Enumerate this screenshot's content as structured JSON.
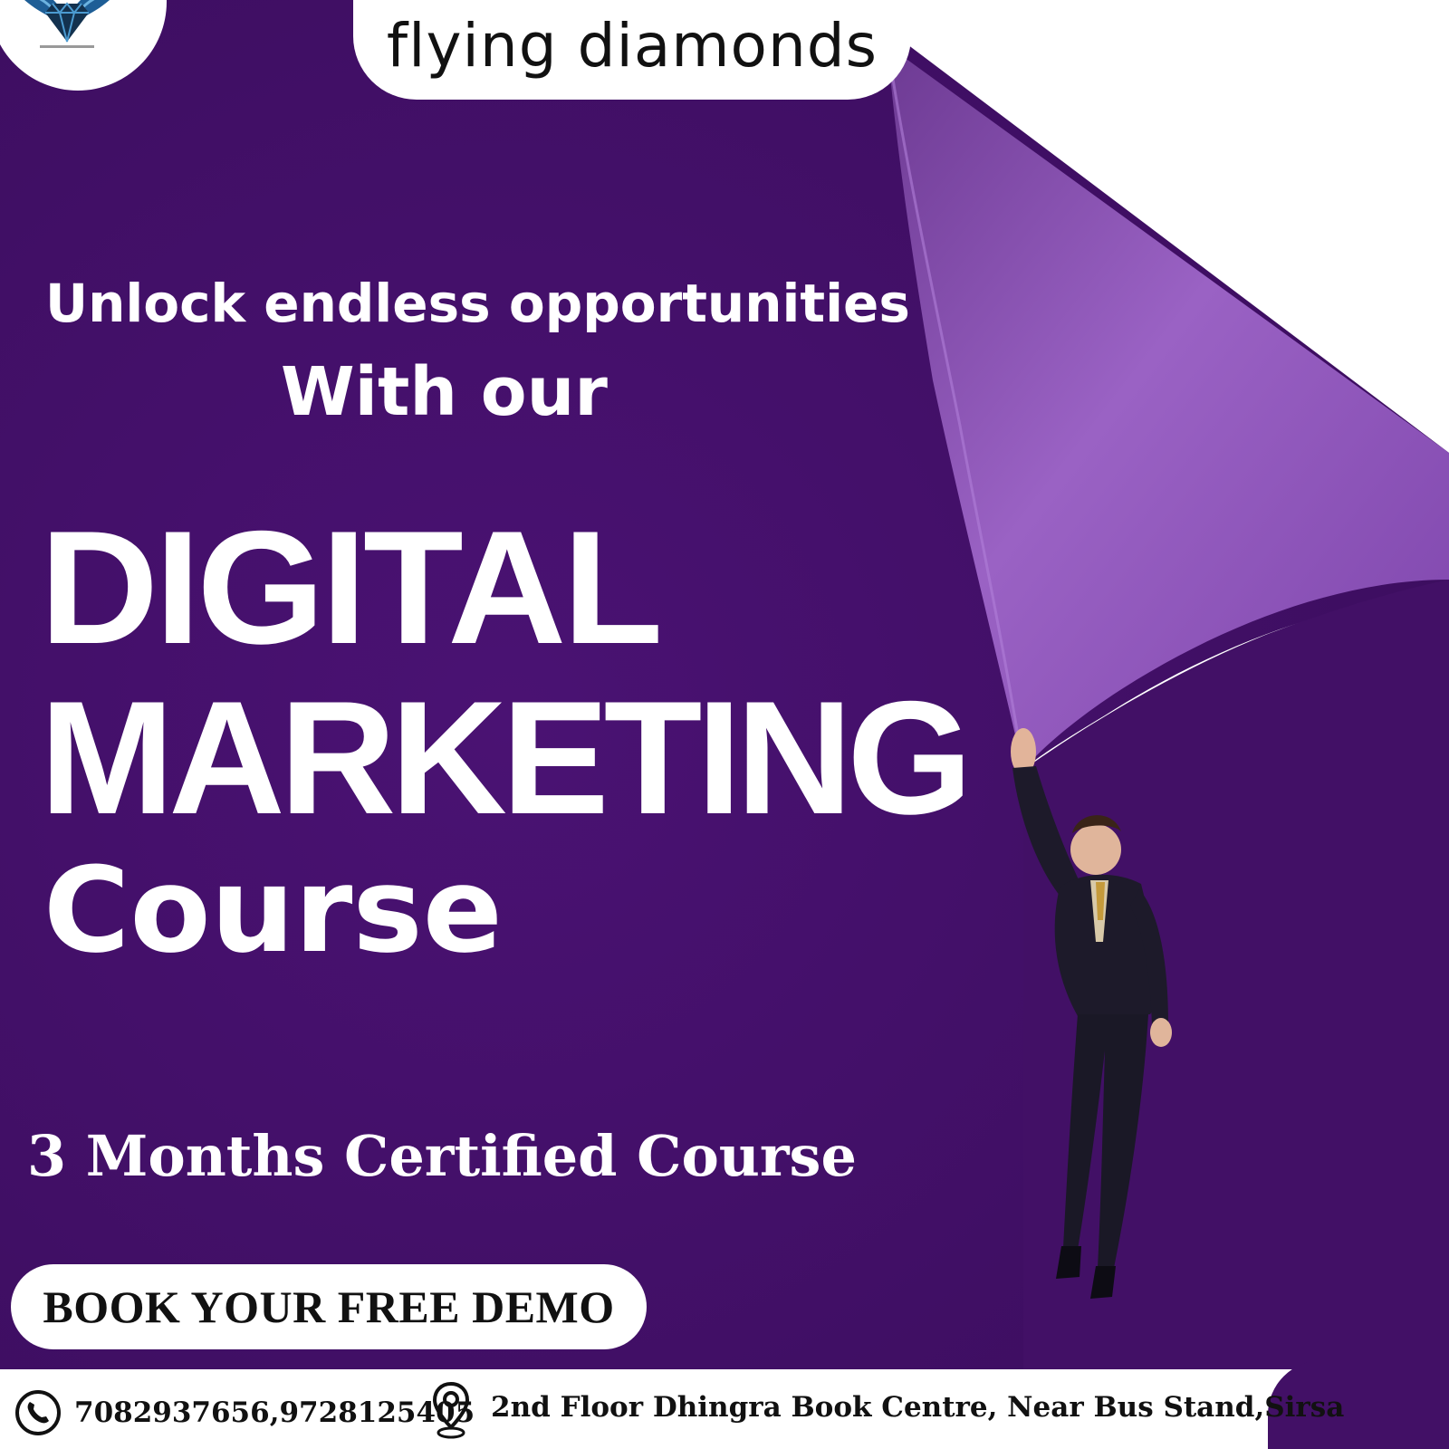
{
  "brand": {
    "name": "flying diamonds",
    "logo_icon": "winged-diamond-halo"
  },
  "headline": {
    "line1": "Unlock endless opportunities",
    "line2": "With our"
  },
  "course": {
    "line1": "DIGITAL",
    "line2": "MARKETING",
    "line3": "Course",
    "duration": "3 Months Certified Course"
  },
  "cta": {
    "label": "BOOK YOUR FREE DEMO"
  },
  "contact": {
    "phone_icon": "phone-icon",
    "phones": "7082937656,9728125405",
    "location_icon": "map-pin-icon",
    "address": "2nd Floor Dhingra Book Centre, Near Bus Stand,Sirsa"
  },
  "colors": {
    "background": "#421066",
    "page_curl": "#8e55b4",
    "text": "#ffffff",
    "accent_dark": "#111111"
  }
}
